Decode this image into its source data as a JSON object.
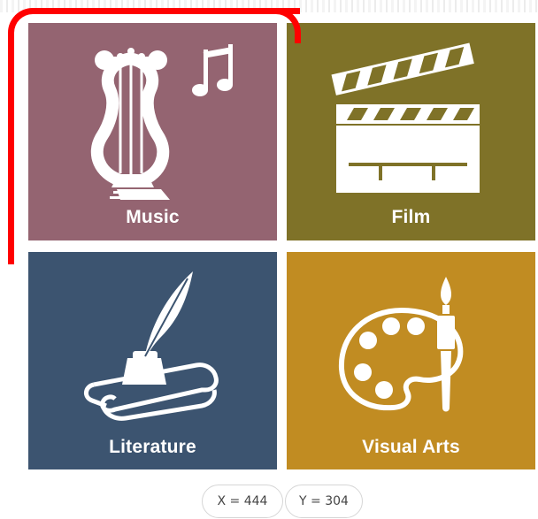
{
  "colors": {
    "music_tile": "#946471",
    "film_tile": "#7f7228",
    "literature_tile": "#3c5470",
    "visual_arts_tile": "#c18c22",
    "highlight": "#ff0000",
    "icon": "#ffffff"
  },
  "tiles": [
    {
      "label": "Music",
      "icon": "lyre-music-note-icon"
    },
    {
      "label": "Film",
      "icon": "clapperboard-icon"
    },
    {
      "label": "Literature",
      "icon": "quill-inkwell-scroll-icon"
    },
    {
      "label": "Visual Arts",
      "icon": "palette-brush-icon"
    }
  ],
  "coordinates": {
    "x_text": "X = 444",
    "y_text": "Y = 304"
  }
}
